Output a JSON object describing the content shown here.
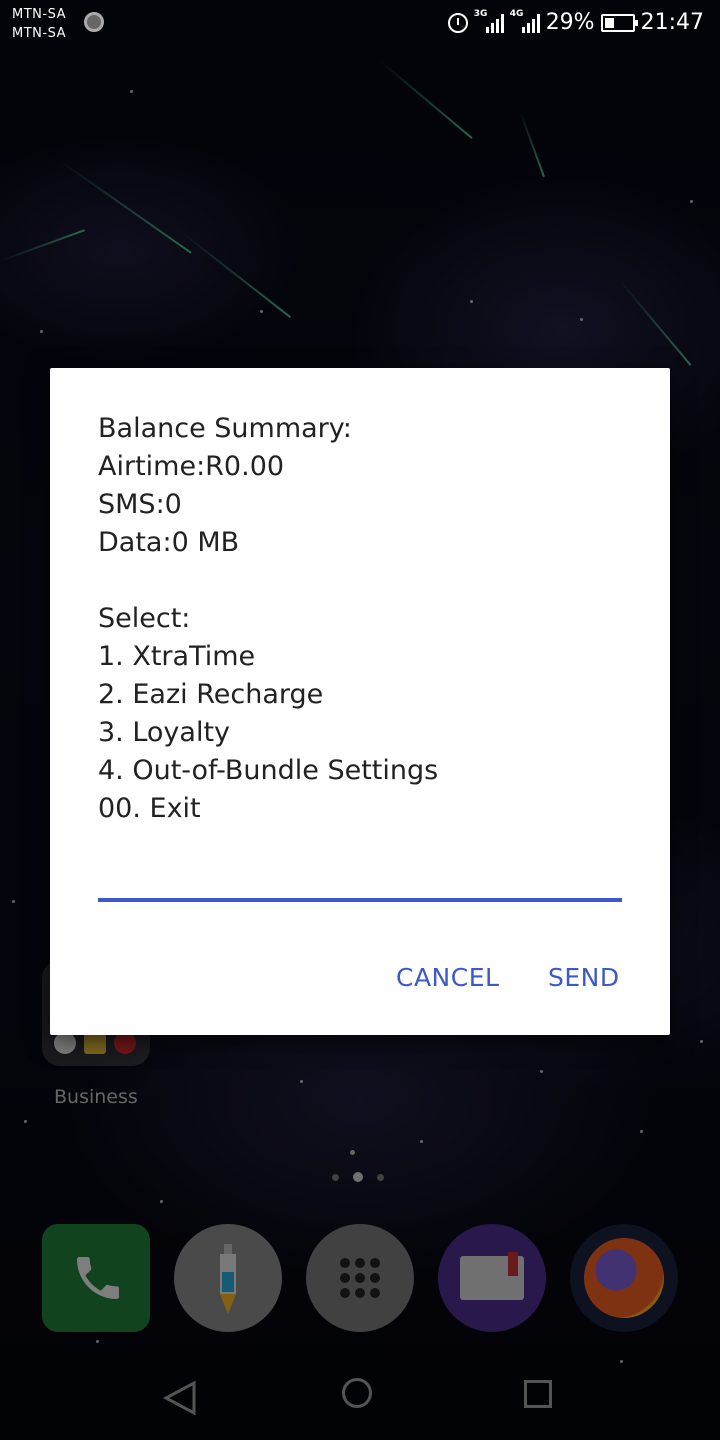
{
  "status_bar": {
    "carrier_1": "MTN-SA",
    "carrier_2": "MTN-SA",
    "network_1": "3G",
    "network_2": "4G",
    "battery": "29%",
    "time": "21:47"
  },
  "home": {
    "folder_label": "Business",
    "page_count": 3,
    "active_page": 2
  },
  "dialog": {
    "lines": [
      "Balance Summary:",
      "Airtime:R0.00",
      "SMS:0",
      "Data:0 MB",
      "",
      "Select:",
      "1. XtraTime",
      "2. Eazi Recharge",
      "3. Loyalty",
      "4. Out-of-Bundle Settings",
      "00. Exit"
    ],
    "input_value": "",
    "cancel_label": "CANCEL",
    "send_label": "SEND",
    "accent_color": "#3a5bc7"
  },
  "dock": [
    "phone-icon",
    "injector-icon",
    "app-drawer-icon",
    "book-icon",
    "firefox-icon"
  ]
}
